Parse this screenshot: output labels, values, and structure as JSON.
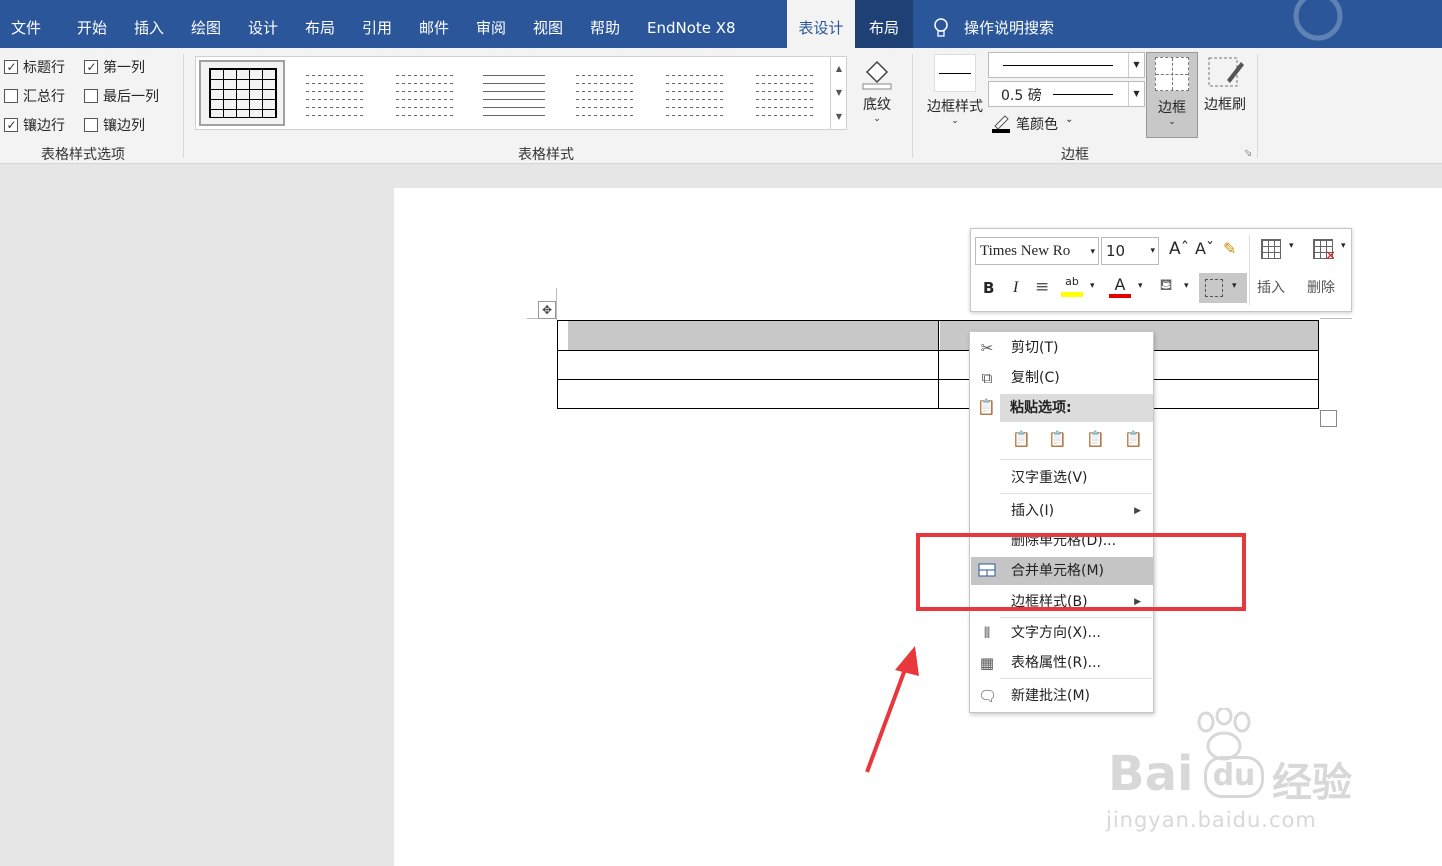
{
  "tabs": [
    "文件",
    "开始",
    "插入",
    "绘图",
    "设计",
    "布局",
    "引用",
    "邮件",
    "审阅",
    "视图",
    "帮助",
    "EndNote X8",
    "表设计",
    "布局"
  ],
  "search_label": "操作说明搜索",
  "style_options": {
    "header_row": "标题行",
    "first_column": "第一列",
    "total_row": "汇总行",
    "last_column": "最后一列",
    "banded_rows": "镶边行",
    "banded_columns": "镶边列",
    "group_label": "表格样式选项"
  },
  "table_styles": {
    "group_label": "表格样式",
    "shading": "底纹"
  },
  "borders": {
    "border_styles": "边框样式",
    "pen_weight": "0.5 磅",
    "pen_color": "笔颜色",
    "borders_button": "边框",
    "border_painter": "边框刷",
    "group_label": "边框"
  },
  "mini_toolbar": {
    "font": "Times New Ro",
    "size": "10",
    "bold": "B",
    "italic": "I",
    "insert": "插入",
    "delete": "删除"
  },
  "context_menu": {
    "cut": "剪切(T)",
    "copy": "复制(C)",
    "paste_options": "粘贴选项:",
    "reconvert": "汉字重选(V)",
    "insert": "插入(I)",
    "delete_cells": "删除单元格(D)...",
    "merge_cells": "合并单元格(M)",
    "border_styles": "边框样式(B)",
    "text_direction": "文字方向(X)...",
    "table_properties": "表格属性(R)...",
    "new_comment": "新建批注(M)"
  },
  "watermark": {
    "brand": "Bai",
    "brand_cn": "经验",
    "url": "jingyan.baidu.com"
  },
  "colors": {
    "ribbon_blue": "#2b579a",
    "highlight_red": "#e8383d",
    "menu_hover": "#c5c5c5"
  }
}
